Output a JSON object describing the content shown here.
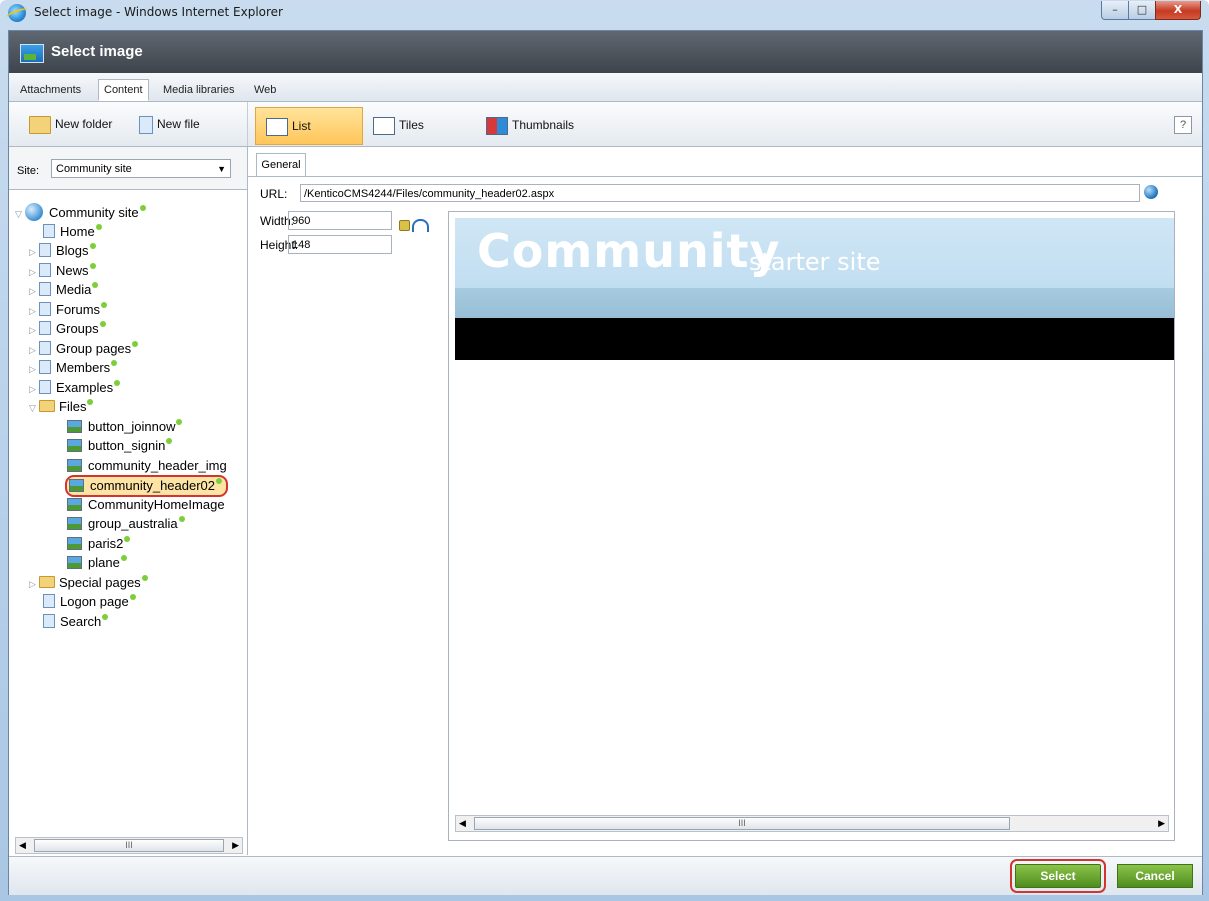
{
  "window": {
    "title": "Select image - Windows Internet Explorer",
    "minimize": "–",
    "maximize": "□",
    "close": "X"
  },
  "dialog": {
    "title": "Select image"
  },
  "tabs": [
    {
      "label": "Attachments"
    },
    {
      "label": "Content"
    },
    {
      "label": "Media libraries"
    },
    {
      "label": "Web"
    }
  ],
  "toolbar": {
    "new_folder": "New folder",
    "new_file": "New file",
    "list": "List",
    "tiles": "Tiles",
    "thumbnails": "Thumbnails",
    "help": "?"
  },
  "site": {
    "label": "Site:",
    "value": "Community site",
    "arrow": "▼"
  },
  "tree": {
    "root": "Community site",
    "items": [
      "Home",
      "Blogs",
      "News",
      "Media",
      "Forums",
      "Groups",
      "Group pages",
      "Members",
      "Examples",
      "Files"
    ],
    "files": [
      "button_joinnow",
      "button_signin",
      "community_header_img",
      "community_header02",
      "CommunityHomeImage",
      "group_australia",
      "paris2",
      "plane"
    ],
    "after": [
      "Special pages",
      "Logon page",
      "Search"
    ]
  },
  "general": {
    "tab": "General",
    "url_label": "URL:",
    "url_value": "/KenticoCMS4244/Files/community_header02.aspx",
    "width_label": "Width:",
    "width_value": "960",
    "height_label": "Height:",
    "height_value": "148"
  },
  "banner": {
    "big": "Community",
    "small": "starter site"
  },
  "scroll": {
    "grip": "III"
  },
  "footer": {
    "select": "Select",
    "cancel": "Cancel"
  }
}
